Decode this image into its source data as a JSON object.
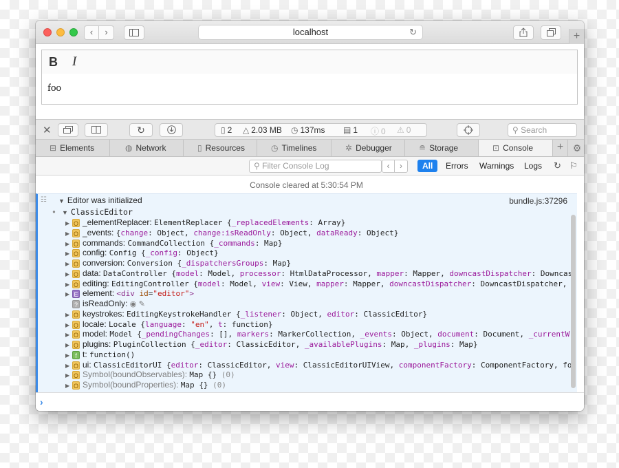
{
  "browser": {
    "url": "localhost",
    "nav": {
      "back": "‹",
      "forward": "›"
    },
    "icons": [
      "sidebar-icon",
      "share-icon",
      "tabs-icon",
      "reload-icon",
      "new-tab-icon"
    ]
  },
  "editor": {
    "bold_label": "B",
    "italic_label": "I",
    "content": "foo"
  },
  "devtools": {
    "stats": {
      "resources": "2",
      "size": "2.03 MB",
      "time": "137ms",
      "logs": "1",
      "errors": "0",
      "warnings": "0"
    },
    "search_placeholder": "Search",
    "tabs": [
      {
        "label": "Elements",
        "icon": "elements-icon"
      },
      {
        "label": "Network",
        "icon": "network-icon"
      },
      {
        "label": "Resources",
        "icon": "resources-icon"
      },
      {
        "label": "Timelines",
        "icon": "timelines-icon"
      },
      {
        "label": "Debugger",
        "icon": "debugger-icon"
      },
      {
        "label": "Storage",
        "icon": "storage-icon"
      },
      {
        "label": "Console",
        "icon": "console-icon",
        "active": true
      }
    ],
    "filter_placeholder": "Filter Console Log",
    "levels": [
      "All",
      "Errors",
      "Warnings",
      "Logs"
    ]
  },
  "console": {
    "cleared": "Console cleared at 5:30:54 PM",
    "message": "Editor was initialized",
    "source": "bundle.js:37296",
    "root": "ClassicEditor",
    "rows": [
      {
        "badge": "O",
        "key": "_elementReplacer",
        "value": "ElementReplacer {_replacedElements: Array}"
      },
      {
        "badge": "O",
        "key": "_events",
        "value": "{change: Object, change:isReadOnly: Object, dataReady: Object}"
      },
      {
        "badge": "O",
        "key": "commands",
        "value": "CommandCollection {_commands: Map}"
      },
      {
        "badge": "O",
        "key": "config",
        "value": "Config {_config: Object}"
      },
      {
        "badge": "O",
        "key": "conversion",
        "value": "Conversion {_dispatchersGroups: Map}"
      },
      {
        "badge": "O",
        "key": "data",
        "value": "DataController {model: Model, processor: HtmlDataProcessor, mapper: Mapper, downcastDispatcher: DowncastDispat"
      },
      {
        "badge": "O",
        "key": "editing",
        "value": "EditingController {model: Model, view: View, mapper: Mapper, downcastDispatcher: DowncastDispatcher, Symbol("
      },
      {
        "badge": "E",
        "key": "element",
        "value": "<div id=\"editor\">"
      },
      {
        "badge": "?",
        "key": "isReadOnly",
        "value": ""
      },
      {
        "badge": "O",
        "key": "keystrokes",
        "value": "EditingKeystrokeHandler {_listener: Object, editor: ClassicEditor}"
      },
      {
        "badge": "O",
        "key": "locale",
        "value": "Locale {language: \"en\", t: function}"
      },
      {
        "badge": "O",
        "key": "model",
        "value": "Model {_pendingChanges: [], markers: MarkerCollection, _events: Object, document: Document, _currentWriter: r"
      },
      {
        "badge": "O",
        "key": "plugins",
        "value": "PluginCollection {_editor: ClassicEditor, _availablePlugins: Map, _plugins: Map}"
      },
      {
        "badge": "f",
        "key": "t",
        "value": "function()"
      },
      {
        "badge": "O",
        "key": "ui",
        "value": "ClassicEditorUI {editor: ClassicEditor, view: ClassicEditorUIView, componentFactory: ComponentFactory, focusTracl"
      },
      {
        "badge": "O",
        "key": "Symbol(boundObservables)",
        "value": "Map {} (0)"
      },
      {
        "badge": "O",
        "key": "Symbol(boundProperties)",
        "value": "Map {} (0)"
      }
    ],
    "prompt": "›"
  },
  "colors": {
    "accent": "#1e81ee",
    "message_bg": "#ecf5fd",
    "property_purple": "#9b1a9b",
    "string_red": "#c41a16"
  }
}
